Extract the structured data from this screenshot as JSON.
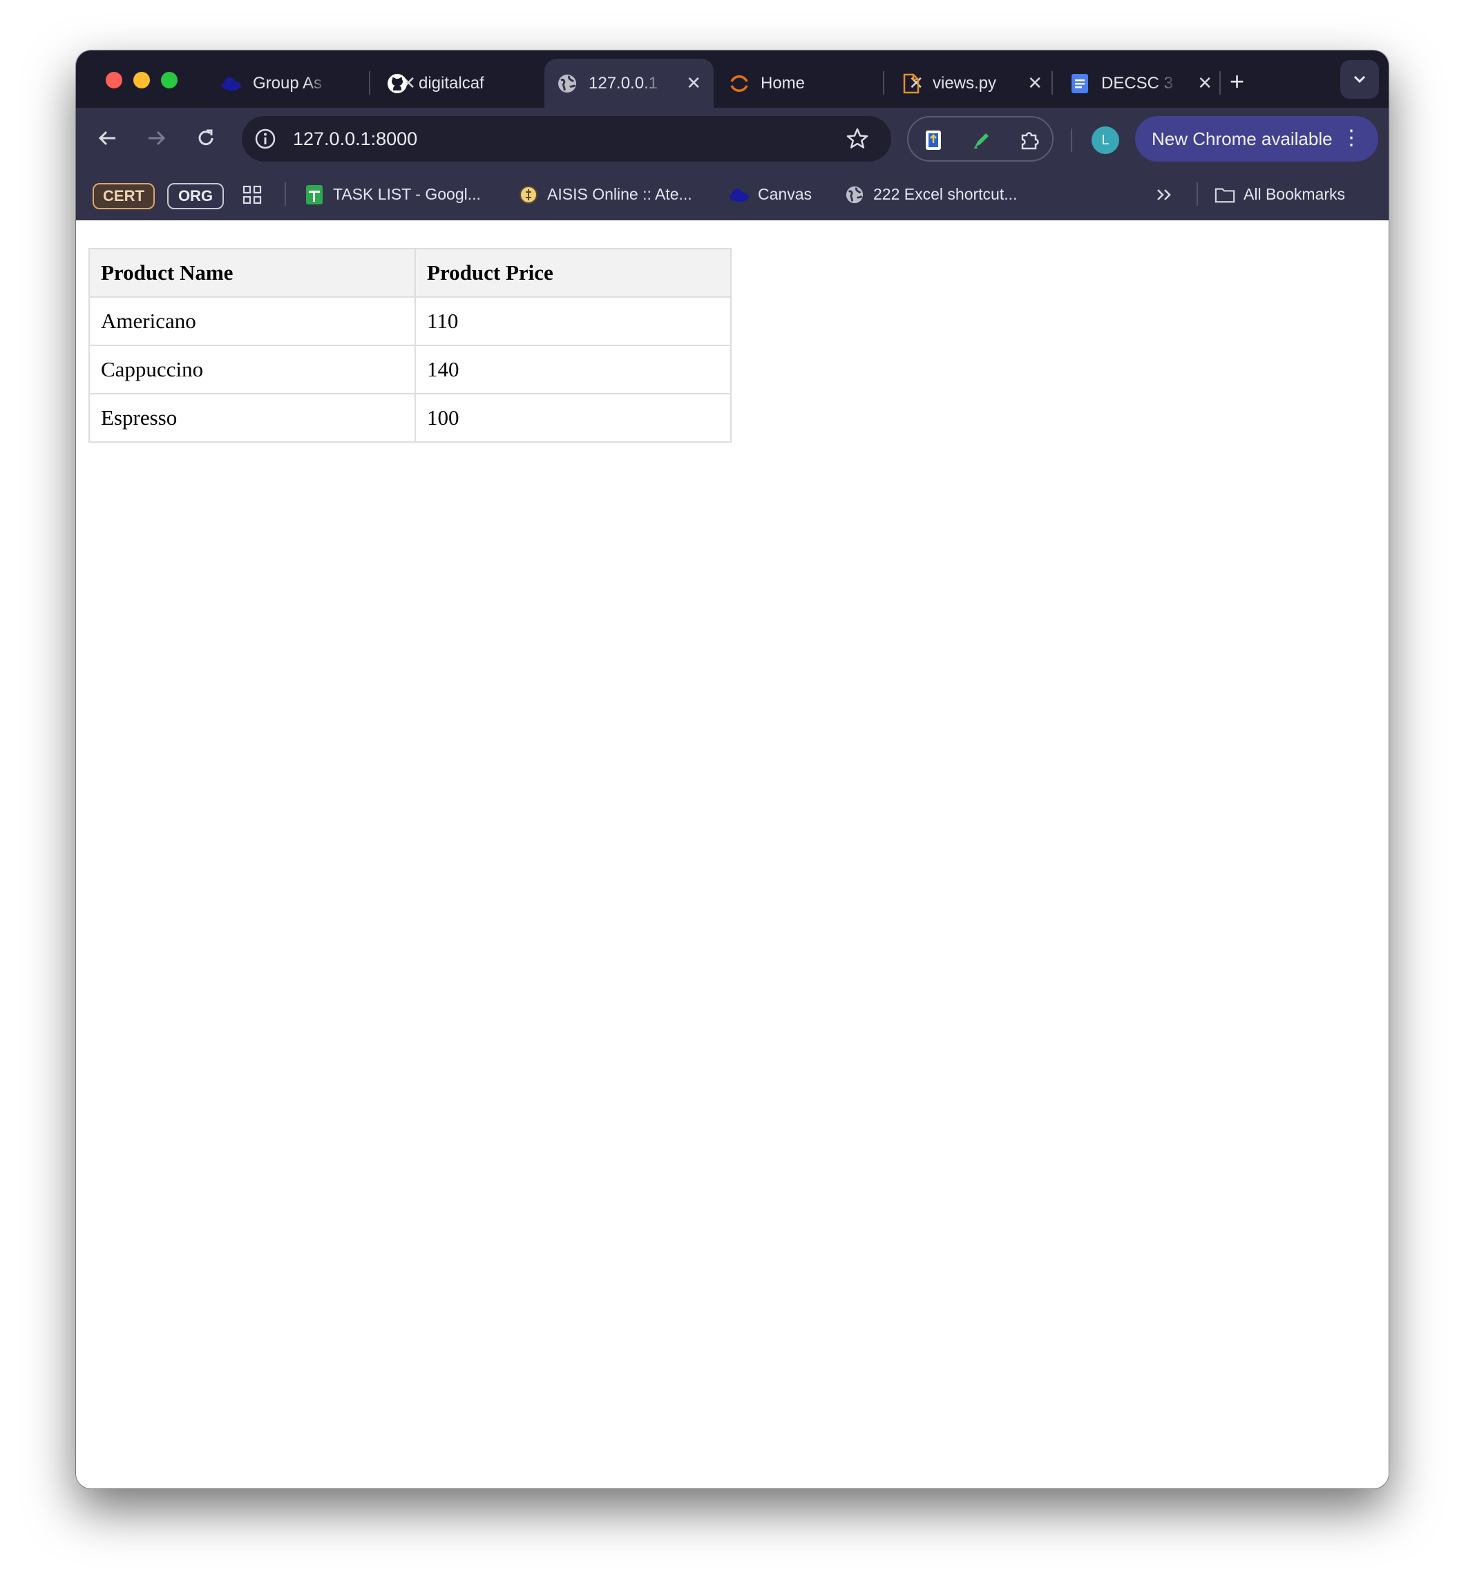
{
  "browser": {
    "tabs": [
      {
        "title": "Group As",
        "icon": "cloud-icon",
        "active": false
      },
      {
        "title": "digitalcaf",
        "icon": "github-icon",
        "active": false
      },
      {
        "title": "127.0.0.1",
        "icon": "globe-icon",
        "active": true
      },
      {
        "title": "Home",
        "icon": "loading-spinner-icon",
        "active": false
      },
      {
        "title": "views.py",
        "icon": "file-icon",
        "active": false
      },
      {
        "title": "DECSC 3",
        "icon": "docs-icon",
        "active": false
      }
    ],
    "address_bar": {
      "url": "127.0.0.1:8000"
    },
    "avatar_initial": "L",
    "update_button_label": "New Chrome available",
    "bookmarks": {
      "chips": [
        "CERT",
        "ORG"
      ],
      "items": [
        {
          "label": "TASK LIST - Googl...",
          "icon": "sheets-icon"
        },
        {
          "label": "AISIS Online :: Ate...",
          "icon": "aisis-icon"
        },
        {
          "label": "Canvas",
          "icon": "cloud-icon"
        },
        {
          "label": "222 Excel shortcut...",
          "icon": "globe-icon"
        }
      ],
      "all_bookmarks_label": "All Bookmarks"
    },
    "colors": {
      "tab_strip": "#1c1b2b",
      "toolbar": "#32324a",
      "update_button": "#41418f",
      "avatar": "#3aa7b4"
    }
  },
  "page": {
    "table": {
      "headers": [
        "Product Name",
        "Product Price"
      ],
      "rows": [
        [
          "Americano",
          "110"
        ],
        [
          "Cappuccino",
          "140"
        ],
        [
          "Espresso",
          "100"
        ]
      ]
    }
  }
}
